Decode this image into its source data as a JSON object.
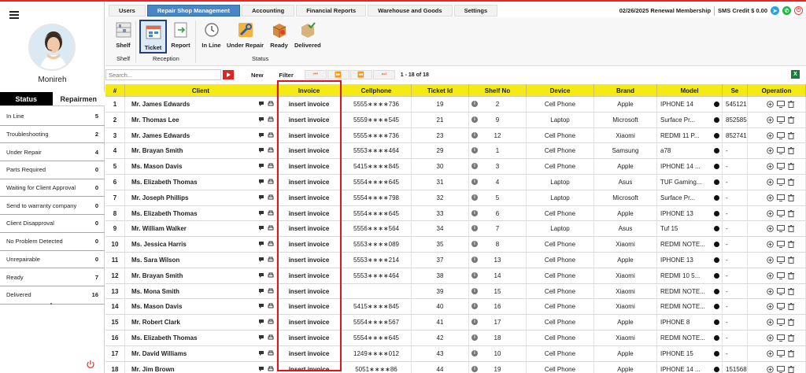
{
  "user": {
    "name": "Monireh"
  },
  "left_tabs": {
    "status": "Status",
    "repairmen": "Repairmen"
  },
  "status_list": [
    {
      "label": "In Line",
      "count": "5"
    },
    {
      "label": "Troubleshooting",
      "count": "2"
    },
    {
      "label": "Under Repair",
      "count": "4"
    },
    {
      "label": "Parts Required",
      "count": "0"
    },
    {
      "label": "Waiting for Client Approval",
      "count": "0"
    },
    {
      "label": "Send to warranty company",
      "count": "0"
    },
    {
      "label": "Client Disapproval",
      "count": "0"
    },
    {
      "label": "No Problem Detected",
      "count": "0"
    },
    {
      "label": "Unrepairable",
      "count": "0"
    },
    {
      "label": "Ready",
      "count": "7"
    },
    {
      "label": "Delivered",
      "count": "16"
    }
  ],
  "nav": {
    "tabs": [
      "Users",
      "Repair Shop Management",
      "Accounting",
      "Financial Reports",
      "Warehouse and Goods",
      "Settings"
    ],
    "active": "Repair Shop Management",
    "renewal": "02/26/2025 Renewal Membership",
    "sms": "SMS Credit $ 0.00"
  },
  "ribbon": {
    "shelf_btn": "Shelf",
    "ticket_btn": "Ticket",
    "report_btn": "Report",
    "inline_btn": "In Line",
    "underrepair_btn": "Under Repair",
    "ready_btn": "Ready",
    "delivered_btn": "Delivered",
    "group_shelf": "Shelf",
    "group_reception": "Reception",
    "group_status": "Status"
  },
  "toolbar": {
    "search_placeholder": "Search...",
    "new_label": "New",
    "filter_label": "Filter",
    "page_info": "1 - 18 of 18"
  },
  "columns": [
    "#",
    "Client",
    "Invoice",
    "Cellphone",
    "Ticket Id",
    "Shelf No",
    "Device",
    "Brand",
    "Model",
    "Se",
    "Operation"
  ],
  "rows": [
    {
      "n": "1",
      "client": "Mr. James Edwards",
      "invoice": "insert invoice",
      "phone": "5555∗∗∗∗736",
      "ticket": "19",
      "shelf": "2",
      "device": "Cell Phone",
      "brand": "Apple",
      "model": "IPHONE 14",
      "serial": "545121"
    },
    {
      "n": "2",
      "client": "Mr. Thomas Lee",
      "invoice": "insert invoice",
      "phone": "5559∗∗∗∗545",
      "ticket": "21",
      "shelf": "9",
      "device": "Laptop",
      "brand": "Microsoft",
      "model": "Surface Pr...",
      "serial": "852585"
    },
    {
      "n": "3",
      "client": "Mr. James Edwards",
      "invoice": "insert invoice",
      "phone": "5555∗∗∗∗736",
      "ticket": "23",
      "shelf": "12",
      "device": "Cell Phone",
      "brand": "Xiaomi",
      "model": "REDMI 11 P...",
      "serial": "852741"
    },
    {
      "n": "4",
      "client": "Mr. Brayan Smith",
      "invoice": "insert invoice",
      "phone": "5553∗∗∗∗464",
      "ticket": "29",
      "shelf": "1",
      "device": "Cell Phone",
      "brand": "Samsung",
      "model": "a78",
      "serial": "-"
    },
    {
      "n": "5",
      "client": "Ms. Mason Davis",
      "invoice": "insert invoice",
      "phone": "5415∗∗∗∗845",
      "ticket": "30",
      "shelf": "3",
      "device": "Cell Phone",
      "brand": "Apple",
      "model": "IPHONE 14 ...",
      "serial": "-"
    },
    {
      "n": "6",
      "client": "Ms. Elizabeth Thomas",
      "invoice": "insert invoice",
      "phone": "5554∗∗∗∗645",
      "ticket": "31",
      "shelf": "4",
      "device": "Laptop",
      "brand": "Asus",
      "model": "TUF Gaming...",
      "serial": "-"
    },
    {
      "n": "7",
      "client": "Mr. Joseph Phillips",
      "invoice": "insert invoice",
      "phone": "5554∗∗∗∗798",
      "ticket": "32",
      "shelf": "5",
      "device": "Laptop",
      "brand": "Microsoft",
      "model": "Surface Pr...",
      "serial": "-"
    },
    {
      "n": "8",
      "client": "Ms. Elizabeth Thomas",
      "invoice": "insert invoice",
      "phone": "5554∗∗∗∗645",
      "ticket": "33",
      "shelf": "6",
      "device": "Cell Phone",
      "brand": "Apple",
      "model": "IPHONE 13",
      "serial": "-"
    },
    {
      "n": "9",
      "client": "Mr. William Walker",
      "invoice": "insert invoice",
      "phone": "5556∗∗∗∗564",
      "ticket": "34",
      "shelf": "7",
      "device": "Laptop",
      "brand": "Asus",
      "model": "Tuf 15",
      "serial": "-"
    },
    {
      "n": "10",
      "client": "Ms. Jessica Harris",
      "invoice": "insert invoice",
      "phone": "5553∗∗∗∗089",
      "ticket": "35",
      "shelf": "8",
      "device": "Cell Phone",
      "brand": "Xiaomi",
      "model": "REDMI NOTE...",
      "serial": "-"
    },
    {
      "n": "11",
      "client": "Ms. Sara Wilson",
      "invoice": "insert invoice",
      "phone": "5553∗∗∗∗214",
      "ticket": "37",
      "shelf": "13",
      "device": "Cell Phone",
      "brand": "Apple",
      "model": "IPHONE 13",
      "serial": "-"
    },
    {
      "n": "12",
      "client": "Mr. Brayan Smith",
      "invoice": "insert invoice",
      "phone": "5553∗∗∗∗464",
      "ticket": "38",
      "shelf": "14",
      "device": "Cell Phone",
      "brand": "Xiaomi",
      "model": "REDMI 10 5...",
      "serial": "-"
    },
    {
      "n": "13",
      "client": "Ms. Mona Smith",
      "invoice": "insert invoice",
      "phone": "",
      "ticket": "39",
      "shelf": "15",
      "device": "Cell Phone",
      "brand": "Xiaomi",
      "model": "REDMI NOTE...",
      "serial": "-"
    },
    {
      "n": "14",
      "client": "Ms. Mason Davis",
      "invoice": "insert invoice",
      "phone": "5415∗∗∗∗845",
      "ticket": "40",
      "shelf": "16",
      "device": "Cell Phone",
      "brand": "Xiaomi",
      "model": "REDMI NOTE...",
      "serial": "-"
    },
    {
      "n": "15",
      "client": "Mr. Robert Clark",
      "invoice": "insert invoice",
      "phone": "5554∗∗∗∗567",
      "ticket": "41",
      "shelf": "17",
      "device": "Cell Phone",
      "brand": "Apple",
      "model": "IPHONE 8",
      "serial": "-"
    },
    {
      "n": "16",
      "client": "Ms. Elizabeth Thomas",
      "invoice": "insert invoice",
      "phone": "5554∗∗∗∗645",
      "ticket": "42",
      "shelf": "18",
      "device": "Cell Phone",
      "brand": "Xiaomi",
      "model": "REDMI NOTE...",
      "serial": "-"
    },
    {
      "n": "17",
      "client": "Mr. David Williams",
      "invoice": "insert invoice",
      "phone": "1249∗∗∗∗012",
      "ticket": "43",
      "shelf": "10",
      "device": "Cell Phone",
      "brand": "Apple",
      "model": "IPHONE 15",
      "serial": "-"
    },
    {
      "n": "18",
      "client": "Mr. Jim Brown",
      "invoice": "insert invoice",
      "phone": "5051∗∗∗∗86",
      "ticket": "44",
      "shelf": "19",
      "device": "Cell Phone",
      "brand": "Apple",
      "model": "IPHONE 14 ...",
      "serial": "151568"
    }
  ]
}
